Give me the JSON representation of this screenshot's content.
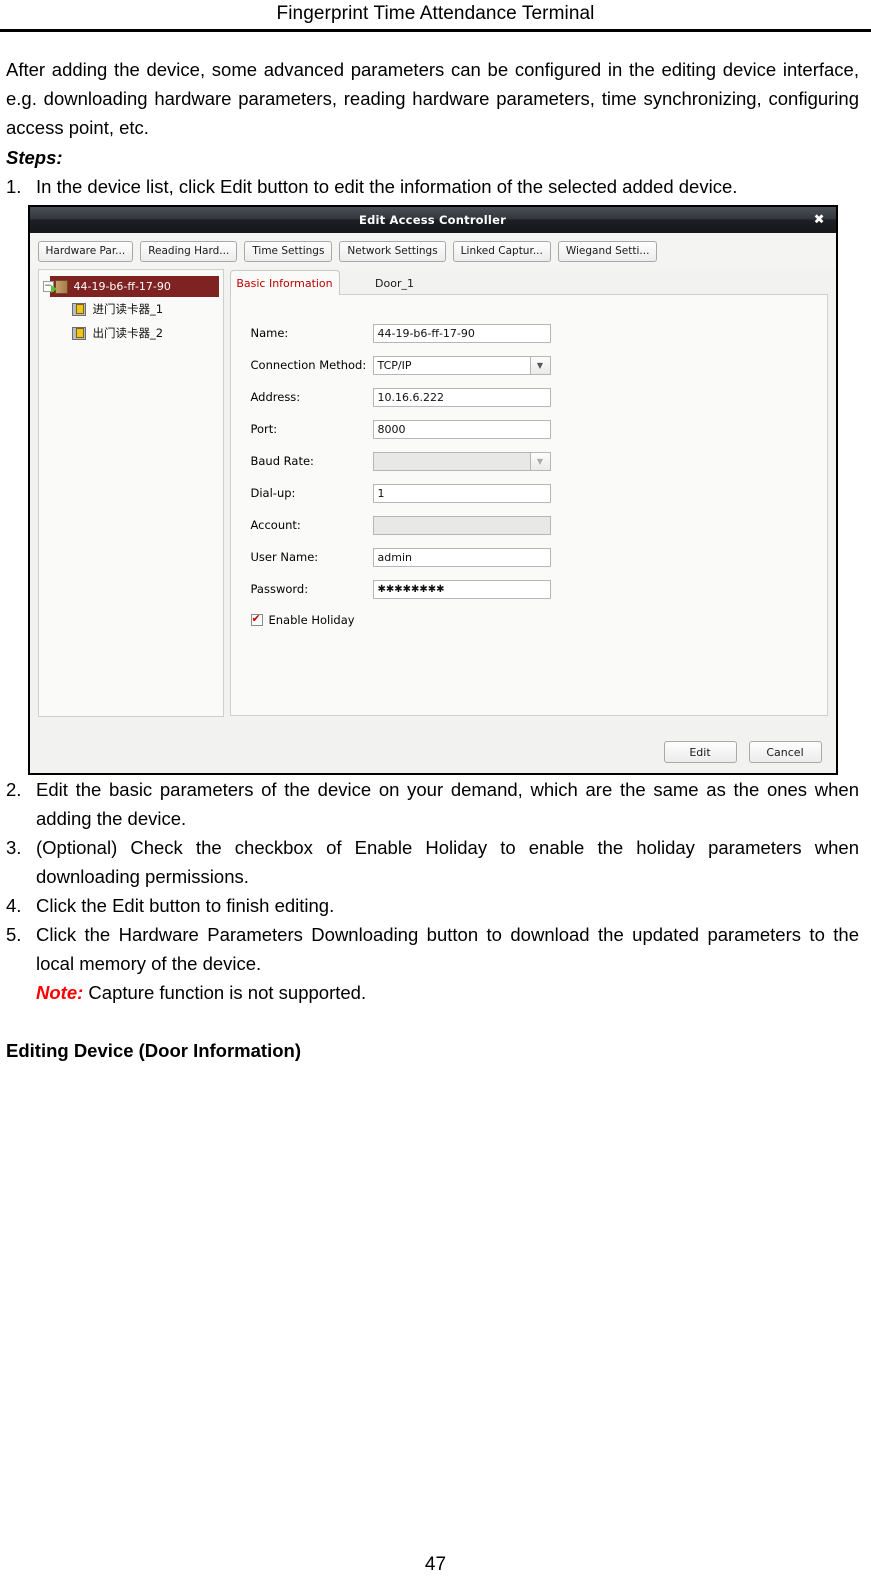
{
  "header": {
    "title": "Fingerprint Time Attendance Terminal"
  },
  "intro": {
    "paragraph": "After adding the device, some advanced parameters can be configured in the editing device interface, e.g. downloading hardware parameters, reading hardware parameters, time synchronizing, configuring access point, etc.",
    "steps_label": "Steps:"
  },
  "steps": [
    {
      "number": "1.",
      "parts": [
        {
          "text": "In the device list, click ",
          "bold": false
        },
        {
          "text": "Edit",
          "bold": true
        },
        {
          "text": " button to edit the information of the selected added device.",
          "bold": false
        }
      ]
    },
    {
      "number": "2.",
      "parts": [
        {
          "text": "Edit the basic parameters of the device on your demand, which are the same as the ones when adding the device.",
          "bold": false
        }
      ]
    },
    {
      "number": "3.",
      "parts": [
        {
          "text": "(Optional) Check the checkbox of ",
          "bold": false
        },
        {
          "text": "Enable Holiday",
          "bold": true
        },
        {
          "text": " to enable the holiday parameters when downloading permissions.",
          "bold": false
        }
      ]
    },
    {
      "number": "4.",
      "parts": [
        {
          "text": "Click the ",
          "bold": false
        },
        {
          "text": "Edit",
          "bold": true
        },
        {
          "text": " button to finish editing.",
          "bold": false
        }
      ]
    },
    {
      "number": "5.",
      "parts": [
        {
          "text": "Click the ",
          "bold": false
        },
        {
          "text": "Hardware Parameters Downloading",
          "bold": true
        },
        {
          "text": " button to download the updated parameters to the local memory of the device.",
          "bold": false
        }
      ]
    }
  ],
  "note": {
    "keyword": "Note:",
    "text": " Capture function is not supported.",
    "color": "#ff0000"
  },
  "section_heading": "Editing Device (Door Information)",
  "dialog": {
    "title": "Edit Access Controller",
    "close_icon": "close-icon",
    "toolbar_buttons": [
      "Hardware Par...",
      "Reading Hard...",
      "Time Settings",
      "Network Settings",
      "Linked Captur...",
      "Wiegand Setti..."
    ],
    "tree": {
      "expander": "−",
      "root": {
        "label": "44-19-b6-ff-17-90",
        "icon": "door-icon",
        "selected_color": "#7e2222"
      },
      "children": [
        {
          "label": "进门读卡器_1",
          "icon": "card-reader-icon"
        },
        {
          "label": "出门读卡器_2",
          "icon": "card-reader-icon"
        }
      ]
    },
    "tabs": [
      {
        "label": "Basic Information",
        "active": true,
        "color": "#c00000"
      },
      {
        "label": "Door_1",
        "active": false
      }
    ],
    "form": {
      "fields": [
        {
          "label": "Name:",
          "value": "44-19-b6-ff-17-90",
          "type": "text",
          "disabled": false
        },
        {
          "label": "Connection Method:",
          "value": "TCP/IP",
          "type": "combo",
          "disabled": false
        },
        {
          "label": "Address:",
          "value": "10.16.6.222",
          "type": "text",
          "disabled": false
        },
        {
          "label": "Port:",
          "value": "8000",
          "type": "text",
          "disabled": false
        },
        {
          "label": "Baud Rate:",
          "value": "",
          "type": "combo",
          "disabled": true
        },
        {
          "label": "Dial-up:",
          "value": "1",
          "type": "text",
          "disabled": false
        },
        {
          "label": "Account:",
          "value": "",
          "type": "text",
          "disabled": true
        },
        {
          "label": "User Name:",
          "value": "admin",
          "type": "text",
          "disabled": false
        },
        {
          "label": "Password:",
          "value": "✱✱✱✱✱✱✱✱",
          "type": "password",
          "disabled": false
        }
      ],
      "checkbox": {
        "label": "Enable Holiday",
        "checked": true
      }
    },
    "footer_buttons": [
      "Edit",
      "Cancel"
    ]
  },
  "page_number": "47"
}
